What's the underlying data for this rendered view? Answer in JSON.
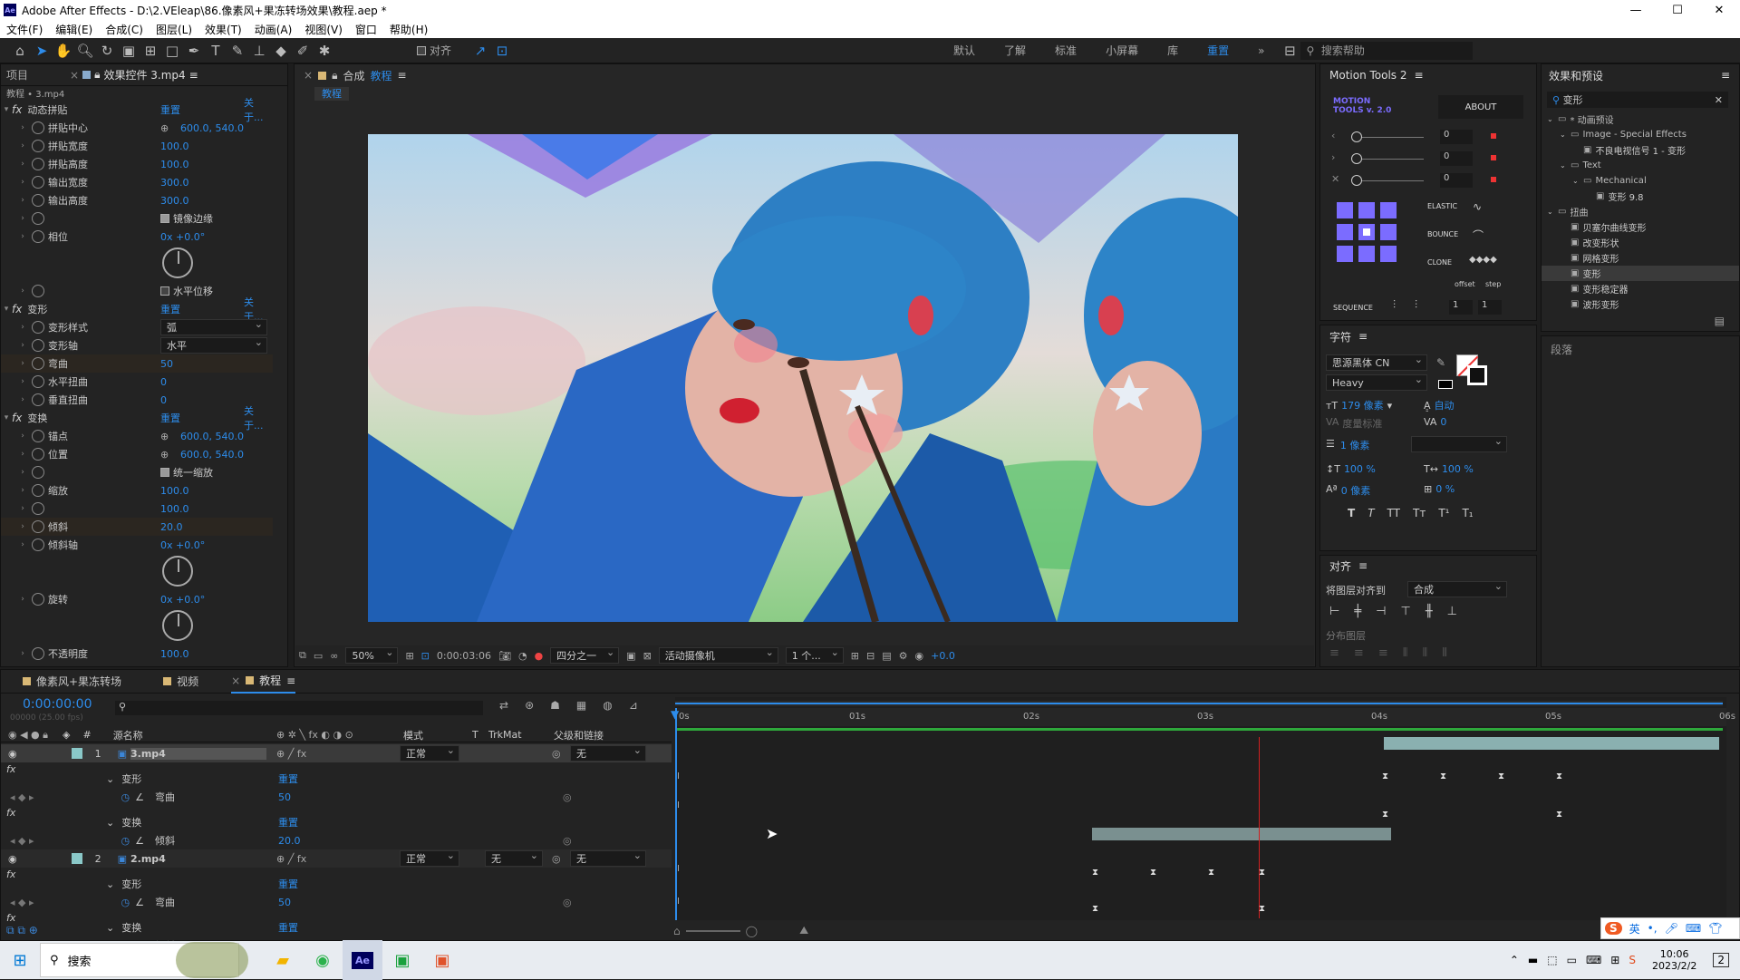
{
  "window": {
    "title": "Adobe After Effects - D:\\2.VEleap\\86.像素风+果冻转场效果\\教程.aep *",
    "app_badge": "Ae",
    "minimize": "—",
    "maximize": "☐",
    "close": "✕"
  },
  "menu": [
    "文件(F)",
    "编辑(E)",
    "合成(C)",
    "图层(L)",
    "效果(T)",
    "动画(A)",
    "视图(V)",
    "窗口",
    "帮助(H)"
  ],
  "toolbar": {
    "align_label": "对齐",
    "workspaces": [
      "默认",
      "了解",
      "标准",
      "小屏幕",
      "库",
      "重置"
    ],
    "active_workspace": "重置",
    "search_help": "搜索帮助"
  },
  "left_panel": {
    "tabs": [
      "项目",
      "效果控件 3.mp4"
    ],
    "breadcrumb": "教程 • 3.mp4",
    "effects": [
      {
        "name": "动态拼贴",
        "reset": "重置",
        "about": "关于...",
        "props": [
          {
            "label": "拼贴中心",
            "value": "600.0, 540.0"
          },
          {
            "label": "拼贴宽度",
            "value": "100.0"
          },
          {
            "label": "拼贴高度",
            "value": "100.0"
          },
          {
            "label": "输出宽度",
            "value": "300.0"
          },
          {
            "label": "输出高度",
            "value": "300.0"
          },
          {
            "label": "",
            "value": "镜像边缘",
            "checkbox": true
          },
          {
            "label": "相位",
            "value": "0x +0.0°"
          },
          {
            "label": "",
            "value": "水平位移",
            "checkbox": false
          }
        ]
      },
      {
        "name": "变形",
        "reset": "重置",
        "about": "关于...",
        "props": [
          {
            "label": "变形样式",
            "value": "弧"
          },
          {
            "label": "变形轴",
            "value": "水平"
          },
          {
            "label": "弯曲",
            "value": "50"
          },
          {
            "label": "水平扭曲",
            "value": "0"
          },
          {
            "label": "垂直扭曲",
            "value": "0"
          }
        ]
      },
      {
        "name": "变换",
        "reset": "重置",
        "about": "关于...",
        "props": [
          {
            "label": "锚点",
            "value": "600.0, 540.0"
          },
          {
            "label": "位置",
            "value": "600.0, 540.0"
          },
          {
            "label": "",
            "value": "统一缩放",
            "checkbox": true
          },
          {
            "label": "缩放",
            "value": "100.0"
          },
          {
            "label": "",
            "value": "100.0"
          },
          {
            "label": "倾斜",
            "value": "20.0"
          },
          {
            "label": "倾斜轴",
            "value": "0x +0.0°"
          },
          {
            "label": "旋转",
            "value": "0x +0.0°"
          },
          {
            "label": "不透明度",
            "value": "100.0"
          }
        ]
      }
    ]
  },
  "comp_panel": {
    "tab_label": "合成",
    "tab_name": "教程",
    "subtab": "教程",
    "zoom": "50%",
    "timecode": "0:00:03:06",
    "resolution": "四分之一",
    "camera": "活动摄像机",
    "views": "1 个...",
    "exposure": "+0.0"
  },
  "motion_tools": {
    "title": "Motion Tools 2",
    "logo_line1": "MOTION",
    "logo_line2": "TOOLS v. 2.0",
    "about": "ABOUT",
    "sliders": [
      {
        "value": "0"
      },
      {
        "value": "0"
      },
      {
        "value": "0"
      }
    ],
    "elastic": "ELASTIC",
    "bounce": "BOUNCE",
    "clone": "CLONE",
    "offset": "offset",
    "step": "step",
    "sequence": "SEQUENCE",
    "seq_offset": "1",
    "seq_step": "1"
  },
  "character": {
    "title": "字符",
    "font": "思源黑体 CN",
    "style": "Heavy",
    "size": "179 像素",
    "leading": "自动",
    "kerning": "度量标准",
    "tracking": "0",
    "stroke": "1 像素",
    "vscale": "100 %",
    "hscale": "100 %",
    "baseline": "0 像素",
    "tsume": "0 %",
    "styles": [
      "T",
      "T",
      "TT",
      "Tт",
      "T¹",
      "T₁"
    ]
  },
  "align": {
    "title": "对齐",
    "align_to_label": "将图层对齐到",
    "align_to_value": "合成",
    "distribute": "分布图层"
  },
  "effects_presets": {
    "title": "效果和预设",
    "search": "变形",
    "tree": [
      {
        "depth": 0,
        "label": "* 动画预设",
        "kind": "folder"
      },
      {
        "depth": 1,
        "label": "Image - Special Effects",
        "kind": "folder"
      },
      {
        "depth": 2,
        "label": "不良电视信号 1 - 变形",
        "kind": "item"
      },
      {
        "depth": 1,
        "label": "Text",
        "kind": "folder"
      },
      {
        "depth": 2,
        "label": "Mechanical",
        "kind": "folder"
      },
      {
        "depth": 3,
        "label": "变形 9.8",
        "kind": "item"
      },
      {
        "depth": 0,
        "label": "扭曲",
        "kind": "folder"
      },
      {
        "depth": 1,
        "label": "贝塞尔曲线变形",
        "kind": "item"
      },
      {
        "depth": 1,
        "label": "改变形状",
        "kind": "item"
      },
      {
        "depth": 1,
        "label": "网格变形",
        "kind": "item"
      },
      {
        "depth": 1,
        "label": "变形",
        "kind": "item",
        "selected": true
      },
      {
        "depth": 1,
        "label": "变形稳定器",
        "kind": "item"
      },
      {
        "depth": 1,
        "label": "波形变形",
        "kind": "item"
      }
    ],
    "paragraph": "段落"
  },
  "timeline": {
    "tabs": [
      "像素风+果冻转场",
      "视频",
      "教程"
    ],
    "active_tab": "教程",
    "timecode": "0:00:00:00",
    "frames": "00000 (25.00 fps)",
    "columns": {
      "source": "源名称",
      "mode": "模式",
      "t": "T",
      "trkmat": "TrkMat",
      "parent": "父级和链接"
    },
    "ruler": [
      "0s",
      "01s",
      "02s",
      "03s",
      "04s",
      "05s",
      "06s"
    ],
    "layers": [
      {
        "num": "1",
        "name": "3.mp4",
        "mode": "正常",
        "trkmat": "",
        "parent": "无"
      },
      {
        "num": "2",
        "name": "2.mp4",
        "mode": "正常",
        "trkmat": "无",
        "parent": "无"
      }
    ],
    "sub": {
      "warp": "变形",
      "bend": "弯曲",
      "bend_val": "50",
      "transform": "变换",
      "skew": "倾斜",
      "skew_val": "20.0",
      "reset": "重置"
    }
  },
  "taskbar": {
    "search": "搜索",
    "time": "10:06",
    "date": "2023/2/2",
    "ime": "英",
    "notif": "2"
  }
}
